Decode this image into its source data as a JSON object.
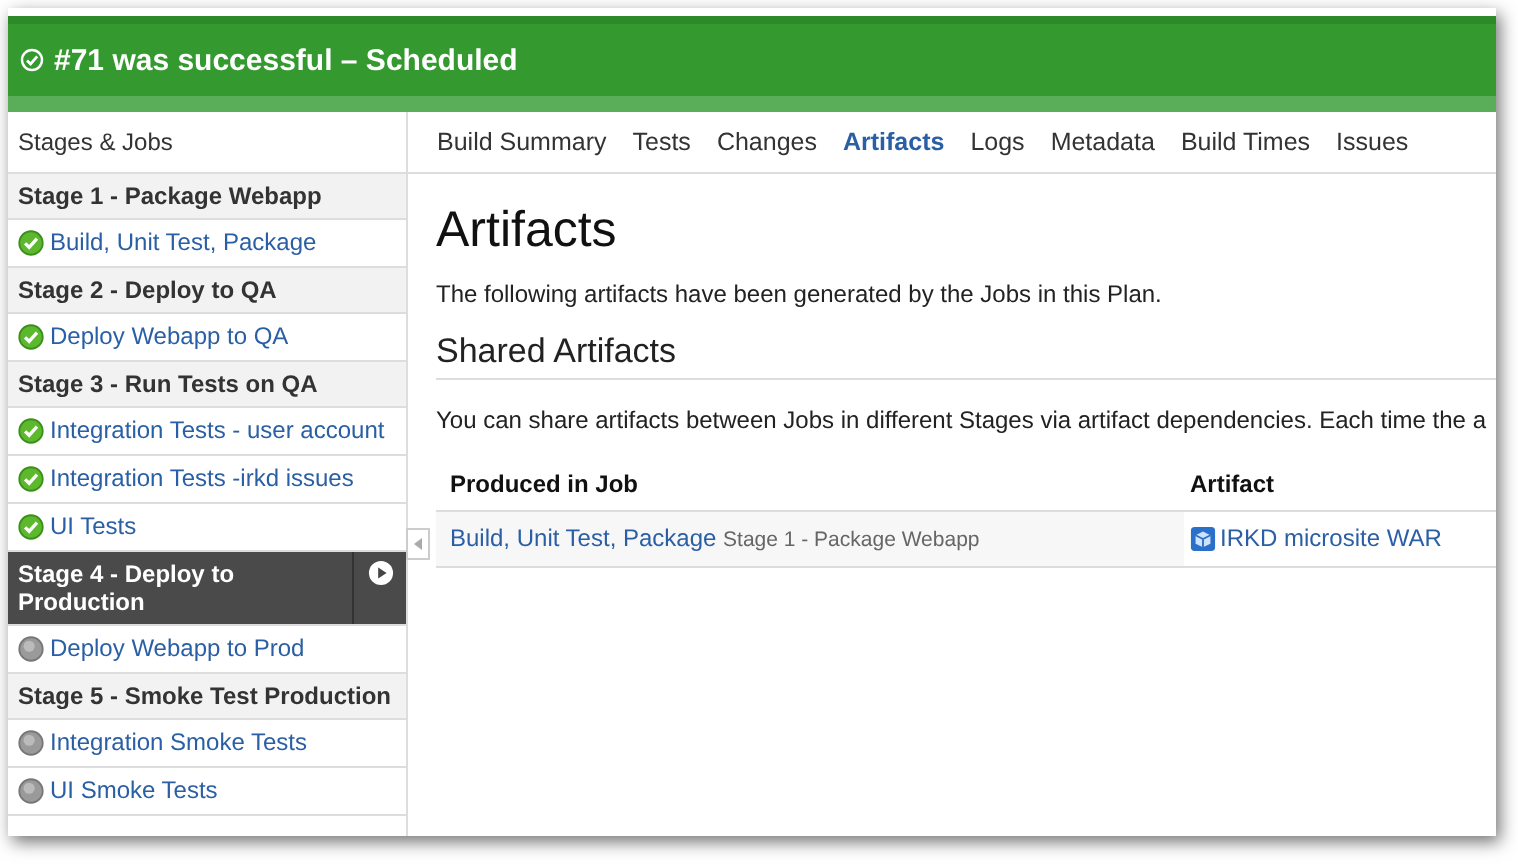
{
  "header": {
    "title": "#71 was successful – Scheduled"
  },
  "sidebar": {
    "title": "Stages & Jobs",
    "items": [
      {
        "kind": "stage",
        "label": "Stage 1 - Package Webapp",
        "selected": false
      },
      {
        "kind": "job",
        "label": "Build, Unit Test, Package",
        "succeeded": true
      },
      {
        "kind": "stage",
        "label": "Stage 2 - Deploy to QA",
        "selected": false
      },
      {
        "kind": "job",
        "label": "Deploy Webapp to QA",
        "succeeded": true
      },
      {
        "kind": "stage",
        "label": "Stage 3 - Run Tests on QA",
        "selected": false
      },
      {
        "kind": "job",
        "label": "Integration Tests - user account",
        "succeeded": true
      },
      {
        "kind": "job",
        "label": "Integration Tests -irkd issues",
        "succeeded": true
      },
      {
        "kind": "job",
        "label": "UI Tests",
        "succeeded": true
      },
      {
        "kind": "stage",
        "label": "Stage 4 - Deploy to Production",
        "selected": true
      },
      {
        "kind": "job",
        "label": "Deploy Webapp to Prod",
        "succeeded": false
      },
      {
        "kind": "stage",
        "label": "Stage 5 - Smoke Test Production",
        "selected": false
      },
      {
        "kind": "job",
        "label": "Integration Smoke Tests",
        "succeeded": false
      },
      {
        "kind": "job",
        "label": "UI Smoke Tests",
        "succeeded": false
      }
    ]
  },
  "tabs": [
    {
      "label": "Build Summary",
      "selected": false
    },
    {
      "label": "Tests",
      "selected": false
    },
    {
      "label": "Changes",
      "selected": false
    },
    {
      "label": "Artifacts",
      "selected": true
    },
    {
      "label": "Logs",
      "selected": false
    },
    {
      "label": "Metadata",
      "selected": false
    },
    {
      "label": "Build Times",
      "selected": false
    },
    {
      "label": "Issues",
      "selected": false
    }
  ],
  "content": {
    "heading": "Artifacts",
    "intro": "The following artifacts have been generated by the Jobs in this Plan.",
    "section": "Shared Artifacts",
    "description": "You can share artifacts between Jobs in different Stages via artifact dependencies. Each time the a",
    "table": {
      "columns": [
        "Produced in Job",
        "Artifact"
      ],
      "rows": [
        {
          "job": "Build, Unit Test, Package",
          "stage": "Stage 1 - Package Webapp",
          "artifact": "IRKD microsite WAR"
        }
      ]
    }
  }
}
